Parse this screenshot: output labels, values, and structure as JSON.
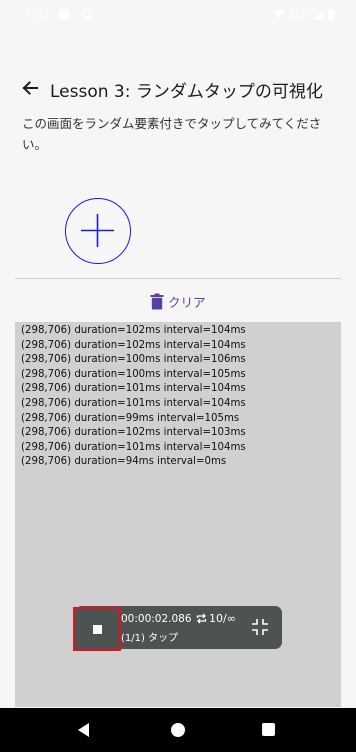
{
  "status_bar": {
    "time": "7:53",
    "network": "LTE"
  },
  "app_bar": {
    "title": "Lesson 3: ランダムタップの可視化"
  },
  "description": "この画面をランダム要素付きでタップしてみてください。",
  "clear_button": {
    "label": "クリア"
  },
  "log": [
    "(298,706) duration=102ms interval=104ms",
    "(298,706) duration=102ms interval=104ms",
    "(298,706) duration=100ms interval=106ms",
    "(298,706) duration=100ms interval=105ms",
    "(298,706) duration=101ms interval=104ms",
    "(298,706) duration=101ms interval=104ms",
    "(298,706) duration=99ms interval=105ms",
    "(298,706) duration=102ms interval=103ms",
    "(298,706) duration=101ms interval=104ms",
    "(298,706) duration=94ms interval=0ms"
  ],
  "overlay": {
    "timer": "00:00:02.086",
    "repeat": "10/∞",
    "status": "(1/1) タップ"
  },
  "colors": {
    "accent_blue": "#1a1adb",
    "clear_purple": "#5b3fa0",
    "highlight_red": "#e0141e"
  }
}
